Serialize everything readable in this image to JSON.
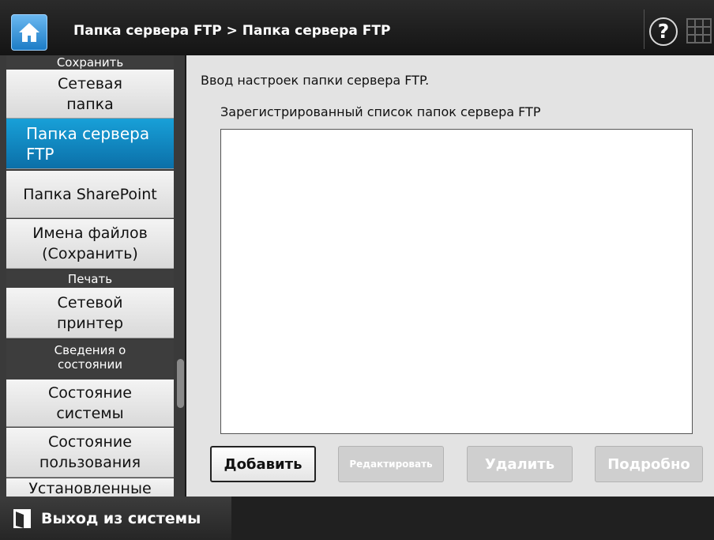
{
  "header": {
    "breadcrumb": "Папка сервера FTP > Папка сервера FTP",
    "help_label": "?"
  },
  "sidebar": {
    "sections": {
      "save": "Сохранить",
      "print": "Печать",
      "status": "Сведения о\nсостоянии"
    },
    "items": [
      {
        "label": "Сетевая\nпапка"
      },
      {
        "label": "Папка сервера\nFTP"
      },
      {
        "label": "Папка SharePoint"
      },
      {
        "label": "Имена файлов\n(Сохранить)"
      },
      {
        "label": "Сетевой\nпринтер"
      },
      {
        "label": "Состояние\nсистемы"
      },
      {
        "label": "Состояние\nпользования"
      },
      {
        "label": "Установленные"
      }
    ]
  },
  "main": {
    "intro": "Ввод настроек папки сервера FTP.",
    "list_label": "Зарегистрированный список папок сервера FTP",
    "buttons": {
      "add": "Добавить",
      "edit": "Редактировать",
      "delete": "Удалить",
      "details": "Подробно"
    }
  },
  "footer": {
    "logout": "Выход из системы"
  },
  "colors": {
    "accent": "#0b7fbf",
    "header_bg": "#1a1a1a",
    "main_bg": "#e3e3e3"
  },
  "icons": [
    "home-icon",
    "help-icon",
    "keyboard-icon",
    "logout-door-icon"
  ]
}
